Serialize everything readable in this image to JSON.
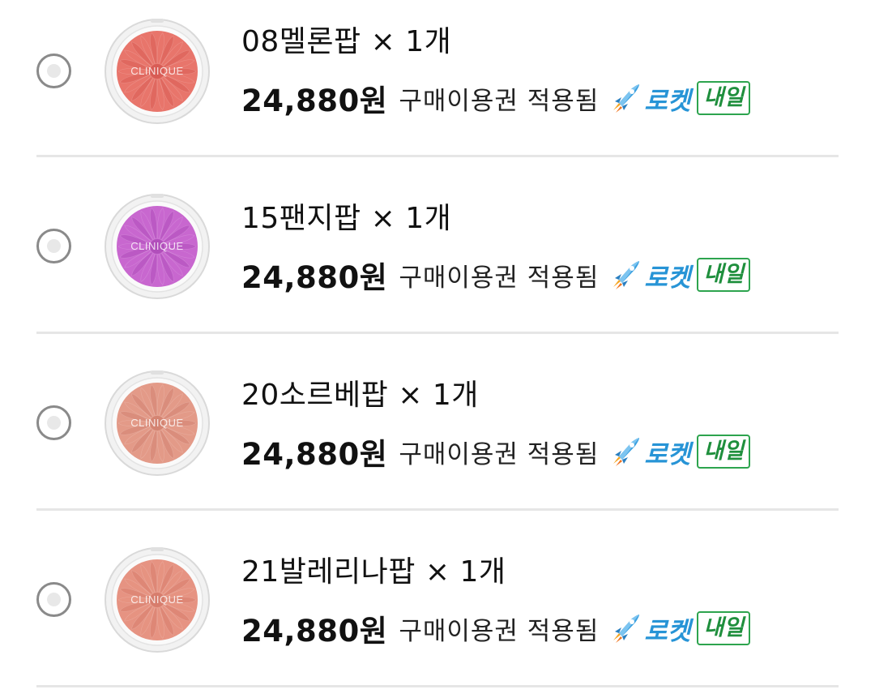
{
  "options": [
    {
      "name": "08멜론팝 × 1개",
      "price": "24,880원",
      "coupon": "구매이용권 적용됨",
      "rocket_label": "로켓",
      "delivery_badge": "내일",
      "swatch_color": "#e8756b",
      "swatch_shade": "#d85c55",
      "brand": "CLINIQUE"
    },
    {
      "name": "15팬지팝 × 1개",
      "price": "24,880원",
      "coupon": "구매이용권 적용됨",
      "rocket_label": "로켓",
      "delivery_badge": "내일",
      "swatch_color": "#c867cf",
      "swatch_shade": "#b14fbb",
      "brand": "CLINIQUE"
    },
    {
      "name": "20소르베팝 × 1개",
      "price": "24,880원",
      "coupon": "구매이용권 적용됨",
      "rocket_label": "로켓",
      "delivery_badge": "내일",
      "swatch_color": "#e39a88",
      "swatch_shade": "#d48472",
      "brand": "CLINIQUE"
    },
    {
      "name": "21발레리나팝 × 1개",
      "price": "24,880원",
      "coupon": "구매이용권 적용됨",
      "rocket_label": "로켓",
      "delivery_badge": "내일",
      "swatch_color": "#e69382",
      "swatch_shade": "#d77d6d",
      "brand": "CLINIQUE"
    }
  ],
  "colors": {
    "rocket_blue": "#2794d6",
    "badge_green": "#1f8f3d",
    "divider": "#e6e6e6",
    "radio_border": "#8a8a8a"
  }
}
